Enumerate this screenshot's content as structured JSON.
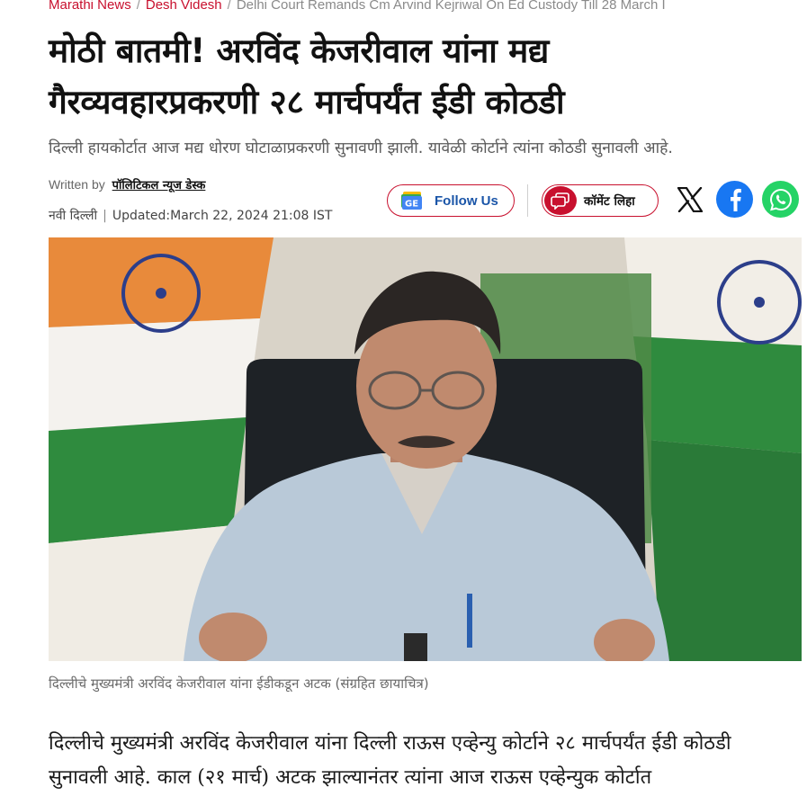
{
  "breadcrumb": {
    "items": [
      "Marathi News",
      "Desh Videsh"
    ],
    "current": "Delhi Court Remands Cm Arvind Kejriwal On Ed Custody Till 28 March I"
  },
  "article": {
    "headline": "मोठी बातमी! अरविंद केजरीवाल यांना मद्य गैरव्यवहारप्रकरणी २८ मार्चपर्यंत ईडी कोठडी",
    "summary": "दिल्ली हायकोर्टात आज मद्य धोरण घोटाळाप्रकरणी सुनावणी झाली. यावेळी कोर्टाने त्यांना कोठडी सुनावली आहे.",
    "written_by_label": "Written by",
    "author": "पॉलिटिकल न्यूज डेस्क",
    "location": "नवी दिल्ली",
    "updated": "Updated:March 22, 2024 21:08 IST",
    "image_caption": "दिल्लीचे मुख्यमंत्री अरविंद केजरीवाल यांना ईडीकडून अटक (संग्रहित छायाचित्र)",
    "body": "दिल्लीचे मुख्यमंत्री अरविंद केजरीवाल यांना दिल्ली राऊस एव्हेन्यु कोर्टाने २८ मार्चपर्यंत ईडी कोठडी सुनावली आहे. काल (२१ मार्च) अटक झाल्यानंतर त्यांना आज राऊस एव्हेन्युक कोर्टात"
  },
  "actions": {
    "follow_label": "Follow Us",
    "comment_label": "कॉमेंट लिहा",
    "icons": {
      "follow": "google-news-icon",
      "comment": "comment-icon",
      "x": "x-icon",
      "facebook": "facebook-icon",
      "whatsapp": "whatsapp-icon"
    }
  },
  "colors": {
    "accent": "#c8102e",
    "follow_text": "#1a55a8",
    "facebook": "#1877f2",
    "whatsapp": "#25d366"
  }
}
